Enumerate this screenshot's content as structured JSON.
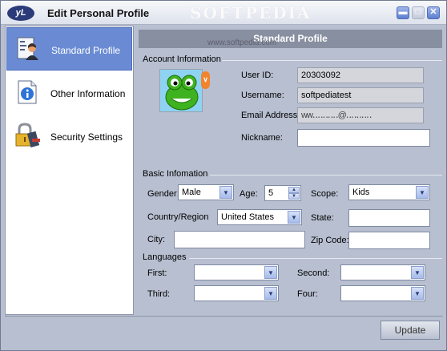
{
  "window": {
    "logo": "yL",
    "title": "Edit Personal Profile",
    "watermark": "SOFTPEDIA",
    "watermark_url": "www.softpedia.com"
  },
  "sidebar": {
    "items": [
      {
        "label": "Standard Profile",
        "icon": "profile-card-icon",
        "active": true
      },
      {
        "label": "Other Information",
        "icon": "info-document-icon",
        "active": false
      },
      {
        "label": "Security Settings",
        "icon": "lock-icon",
        "active": false
      }
    ]
  },
  "main": {
    "header": "Standard Profile",
    "account": {
      "section_title": "Account Information",
      "user_id_label": "User ID:",
      "user_id": "20303092",
      "username_label": "Username:",
      "username": "softpediatest",
      "email_label": "Email Address:",
      "email": "ww‥‥‥‥‥@‥‥‥‥‥",
      "nickname_label": "Nickname:",
      "nickname": ""
    },
    "basic": {
      "section_title": "Basic Infomation",
      "gender_label": "Gender:",
      "gender": "Male",
      "age_label": "Age:",
      "age": "5",
      "scope_label": "Scope:",
      "scope": "Kids",
      "country_label": "Country/Region",
      "country": "United States",
      "state_label": "State:",
      "state": "",
      "city_label": "City:",
      "city": "",
      "zip_label": "Zip Code:",
      "zip": ""
    },
    "languages": {
      "section_title": "Languages",
      "first_label": "First:",
      "second_label": "Second:",
      "third_label": "Third:",
      "four_label": "Four:",
      "first": "",
      "second": "",
      "third": "",
      "four": ""
    }
  },
  "footer": {
    "update_label": "Update"
  },
  "colors": {
    "window_bg": "#b7bfd0",
    "active_nav": "#6a8bd3",
    "header_bg": "#888fa0"
  }
}
